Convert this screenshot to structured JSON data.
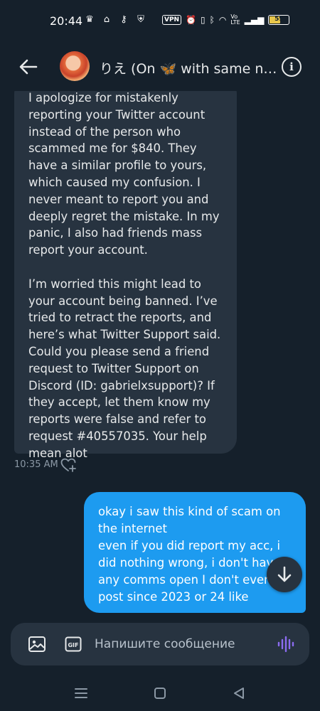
{
  "status_bar": {
    "time": "20:44",
    "vpn_label": "VPN",
    "battery_percent": "59",
    "battery_level": 0.59,
    "colors": {
      "battery_fill": "#e8c64a"
    }
  },
  "header": {
    "title": "りえ (On 🦋 with same na...",
    "icons": [
      "back-arrow-icon",
      "avatar",
      "info-icon"
    ]
  },
  "conversation": {
    "incoming": {
      "text": "I apologize for mistakenly reporting your Twitter account instead of the person who scammed me for $840. They have a similar profile to yours, which caused my confusion. I never meant to report you and deeply regret the mistake. In my panic, I also had friends mass report your account.\n\nI’m worried this might lead to your account being banned. I’ve tried to retract the reports, and here’s what Twitter Support said. Could you please send a friend request to Twitter Support on Discord (ID: gabrielxsupport)? If they accept, let them know my reports were false and refer to request #40557035. Your help mean alot",
      "time": "10:35 AM"
    },
    "outgoing": {
      "text": "okay i saw this kind of scam on the internet\neven if you did report my acc, i did nothing wrong, i don't have any comms open I don't even post since 2023 or 24 like"
    }
  },
  "composer": {
    "placeholder": "Напишите сообщение",
    "media_label": "GIF"
  },
  "colors": {
    "background": "#15202b",
    "incoming_bubble": "#273340",
    "outgoing_bubble": "#1d9bf0",
    "accent_voice": "#8b6cf0"
  }
}
